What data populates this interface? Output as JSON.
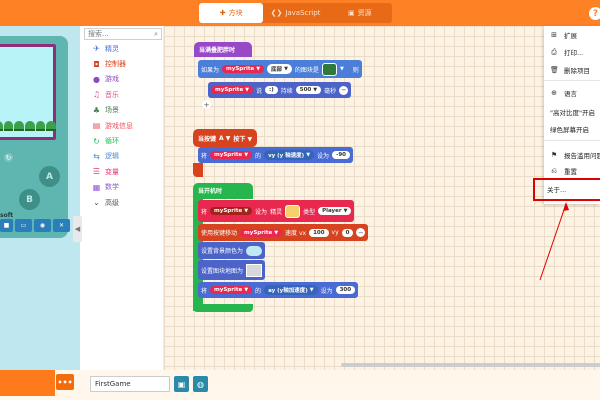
{
  "header": {
    "tabs": [
      {
        "label": "方块",
        "icon": "puzzle-icon",
        "active": true
      },
      {
        "label": "JavaScript",
        "icon": "code-icon",
        "active": false
      },
      {
        "label": "资源",
        "icon": "image-icon",
        "active": false
      }
    ],
    "help_label": "?",
    "bar_color": "#ff8126"
  },
  "simulator": {
    "brand": "soft",
    "button_a": "A",
    "button_b": "B",
    "tool_icons": [
      "stop-icon",
      "fullscreen-icon",
      "camera-icon",
      "close-icon"
    ]
  },
  "toolbox": {
    "search_placeholder": "搜索...",
    "categories": [
      {
        "label": "精灵",
        "color": "#4b6cd8",
        "icon": "sprite-icon"
      },
      {
        "label": "控制器",
        "color": "#d54322",
        "icon": "gamepad-icon"
      },
      {
        "label": "游戏",
        "color": "#8b49c2",
        "icon": "game-icon"
      },
      {
        "label": "音乐",
        "color": "#e74e8c",
        "icon": "headphones-icon"
      },
      {
        "label": "场景",
        "color": "#4b7f52",
        "icon": "tree-icon"
      },
      {
        "label": "游戏信息",
        "color": "#e8515d",
        "icon": "info-icon"
      },
      {
        "label": "循环",
        "color": "#20bf55",
        "icon": "loop-icon"
      },
      {
        "label": "逻辑",
        "color": "#4a86d6",
        "icon": "logic-icon"
      },
      {
        "label": "变量",
        "color": "#e9386b",
        "icon": "variable-icon"
      },
      {
        "label": "数学",
        "color": "#8e59cf",
        "icon": "math-icon"
      }
    ],
    "advanced_label": "高级"
  },
  "workspace": {
    "blocks": {
      "overlap_hat": "当满叠肥胖时",
      "overlap_if": "如果为",
      "overlap_sprite": "mySprite",
      "overlap_edge": "底部",
      "overlap_tile": "的图块是",
      "overlap_then": "则",
      "say_sprite": "mySprite",
      "say_text": "说",
      "say_value": ":)",
      "say_hold": "持续",
      "say_ms": "500",
      "say_ms_unit": "毫秒",
      "button_hat_prefix": "当按键",
      "button_key": "A",
      "button_event": "按下",
      "set_label": "将",
      "set_sprite": "mySprite",
      "set_prop": "的",
      "set_vy": "vy (y 轴速度)",
      "set_to": "设为",
      "set_vy_value": "-90",
      "start_hat": "当开机时",
      "create_set": "将",
      "create_sprite": "mySprite",
      "create_to": "设为",
      "create_of_type": "精灵",
      "create_type_label": "类型",
      "create_type_value": "Player",
      "move_label": "使用按键移动",
      "move_sprite": "mySprite",
      "move_speed": "速度 vx",
      "move_vx": "100",
      "move_vy_label": "vy",
      "move_vy": "0",
      "bg_color_label": "设置背景颜色为",
      "bg_image_label": "设置图块地图为",
      "ay_set": "将",
      "ay_sprite": "mySprite",
      "ay_prop": "的",
      "ay_label": "ay (y轴加速度)",
      "ay_to": "设为",
      "ay_value": "300"
    }
  },
  "context_menu": {
    "items": [
      {
        "label": "扩展",
        "icon": "plus-box-icon"
      },
      {
        "label": "打印...",
        "icon": "print-icon"
      },
      {
        "label": "删除项目",
        "icon": "trash-icon"
      },
      {
        "label": "语言",
        "icon": "globe-icon"
      },
      {
        "label": "\"高对比度\"开启",
        "icon": ""
      },
      {
        "label": "绿色屏幕开启",
        "icon": ""
      },
      {
        "label": "报告滥用问题",
        "icon": "flag-icon"
      },
      {
        "label": "重置",
        "icon": "reset-icon"
      },
      {
        "label": "关于...",
        "icon": ""
      }
    ]
  },
  "footer": {
    "project_name": "FirstGame",
    "dots_label": "•••",
    "save_icon": "save-icon",
    "github_icon": "github-icon"
  },
  "colors": {
    "orange": "#ff8126",
    "annotation_red": "#e00000"
  }
}
